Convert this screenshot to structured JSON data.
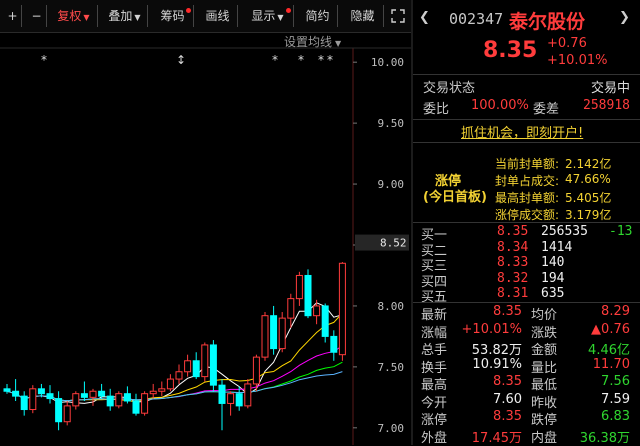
{
  "toolbar": {
    "plus": "+",
    "minus": "−",
    "fuquan": "复权",
    "diejia": "叠加",
    "chouma": "筹码",
    "huaxian": "画线",
    "xianshi": "显示",
    "jianyue": "简约",
    "yincang": "隐藏",
    "settings_ma": "设置均线"
  },
  "chart": {
    "y_ticks": [
      "10.00",
      "9.50",
      "9.00",
      "8.50",
      "8.00",
      "7.50",
      "7.00"
    ],
    "current_price_tag": "8.52",
    "markers": [
      "*",
      "↕",
      "*",
      "*",
      "*",
      "*"
    ]
  },
  "chart_data": {
    "type": "candlestick",
    "ylim": [
      6.9,
      10.1
    ],
    "candles": [
      [
        7.32,
        7.36,
        7.28,
        7.3
      ],
      [
        7.3,
        7.4,
        7.22,
        7.26
      ],
      [
        7.26,
        7.3,
        7.1,
        7.15
      ],
      [
        7.15,
        7.35,
        7.12,
        7.32
      ],
      [
        7.32,
        7.36,
        7.25,
        7.28
      ],
      [
        7.28,
        7.35,
        7.2,
        7.24
      ],
      [
        7.24,
        7.3,
        6.98,
        7.05
      ],
      [
        7.05,
        7.22,
        7.02,
        7.18
      ],
      [
        7.18,
        7.3,
        7.15,
        7.28
      ],
      [
        7.28,
        7.38,
        7.22,
        7.25
      ],
      [
        7.25,
        7.32,
        7.18,
        7.3
      ],
      [
        7.3,
        7.36,
        7.24,
        7.26
      ],
      [
        7.26,
        7.32,
        7.14,
        7.18
      ],
      [
        7.18,
        7.3,
        7.16,
        7.28
      ],
      [
        7.28,
        7.34,
        7.2,
        7.22
      ],
      [
        7.22,
        7.28,
        7.1,
        7.12
      ],
      [
        7.12,
        7.3,
        7.1,
        7.28
      ],
      [
        7.28,
        7.36,
        7.24,
        7.3
      ],
      [
        7.3,
        7.38,
        7.26,
        7.32
      ],
      [
        7.32,
        7.44,
        7.3,
        7.4
      ],
      [
        7.4,
        7.52,
        7.36,
        7.46
      ],
      [
        7.46,
        7.6,
        7.42,
        7.55
      ],
      [
        7.55,
        7.62,
        7.4,
        7.42
      ],
      [
        7.42,
        7.7,
        7.38,
        7.68
      ],
      [
        7.68,
        7.72,
        7.3,
        7.35
      ],
      [
        7.35,
        7.4,
        6.98,
        7.2
      ],
      [
        7.2,
        7.3,
        7.1,
        7.28
      ],
      [
        7.28,
        7.34,
        7.14,
        7.18
      ],
      [
        7.18,
        7.4,
        7.16,
        7.36
      ],
      [
        7.36,
        7.6,
        7.3,
        7.58
      ],
      [
        7.58,
        7.95,
        7.55,
        7.92
      ],
      [
        7.92,
        8.0,
        7.6,
        7.65
      ],
      [
        7.65,
        7.95,
        7.62,
        7.9
      ],
      [
        7.9,
        8.1,
        7.82,
        8.06
      ],
      [
        8.06,
        8.28,
        8.0,
        8.25
      ],
      [
        8.25,
        8.3,
        7.9,
        7.92
      ],
      [
        7.92,
        8.05,
        7.85,
        8.0
      ],
      [
        8.0,
        8.02,
        7.7,
        7.75
      ],
      [
        7.75,
        7.8,
        7.55,
        7.62
      ],
      [
        7.6,
        8.36,
        7.55,
        8.35
      ]
    ]
  },
  "header": {
    "code": "002347",
    "name": "泰尔股份",
    "price": "8.35",
    "change": "+0.76",
    "change_pct": "+10.01%"
  },
  "status": {
    "label": "交易状态",
    "value": "交易中",
    "weibi_label": "委比",
    "weibi_value": "100.00%",
    "weicha_label": "委差",
    "weicha_value": "258918",
    "promo": "抓住机会，即刻开户!"
  },
  "limit": {
    "title1": "涨停",
    "title2": "(今日首板)",
    "rows": [
      {
        "k": "当前封单额:",
        "v": "2.142亿"
      },
      {
        "k": "封单占成交:",
        "v": "47.66%"
      },
      {
        "k": "最高封单额:",
        "v": "5.405亿"
      },
      {
        "k": "涨停成交额:",
        "v": "3.179亿"
      }
    ]
  },
  "orderbook": [
    {
      "label": "买一",
      "price": "8.35",
      "vol": "256535",
      "chg": "-13"
    },
    {
      "label": "买二",
      "price": "8.34",
      "vol": "1414",
      "chg": ""
    },
    {
      "label": "买三",
      "price": "8.33",
      "vol": "140",
      "chg": ""
    },
    {
      "label": "买四",
      "price": "8.32",
      "vol": "194",
      "chg": ""
    },
    {
      "label": "买五",
      "price": "8.31",
      "vol": "635",
      "chg": ""
    }
  ],
  "quote": [
    {
      "l1": "最新",
      "v1": "8.35",
      "c1": "red",
      "l2": "均价",
      "v2": "8.29",
      "c2": "red"
    },
    {
      "l1": "涨幅",
      "v1": "+10.01%",
      "c1": "red",
      "l2": "涨跌",
      "v2": "▲0.76",
      "c2": "red"
    },
    {
      "l1": "总手",
      "v1": "53.82万",
      "c1": "white",
      "l2": "金额",
      "v2": "4.46亿",
      "c2": "green"
    },
    {
      "l1": "换手",
      "v1": "10.91%",
      "c1": "white",
      "l2": "量比",
      "v2": "11.70",
      "c2": "red"
    },
    {
      "l1": "最高",
      "v1": "8.35",
      "c1": "red",
      "l2": "最低",
      "v2": "7.56",
      "c2": "green"
    },
    {
      "l1": "今开",
      "v1": "7.60",
      "c1": "white",
      "l2": "昨收",
      "v2": "7.59",
      "c2": "white"
    },
    {
      "l1": "涨停",
      "v1": "8.35",
      "c1": "red",
      "l2": "跌停",
      "v2": "6.83",
      "c2": "green"
    },
    {
      "l1": "外盘",
      "v1": "17.45万",
      "c1": "red",
      "l2": "内盘",
      "v2": "36.38万",
      "c2": "green"
    }
  ],
  "colors": {
    "up": "#ff3c3c",
    "down": "#00ffff",
    "ma5": "#ffffff",
    "ma10": "#ffd700",
    "ma20": "#ff00ff",
    "ma30": "#00ff00",
    "ma60": "#5ab4ff"
  }
}
